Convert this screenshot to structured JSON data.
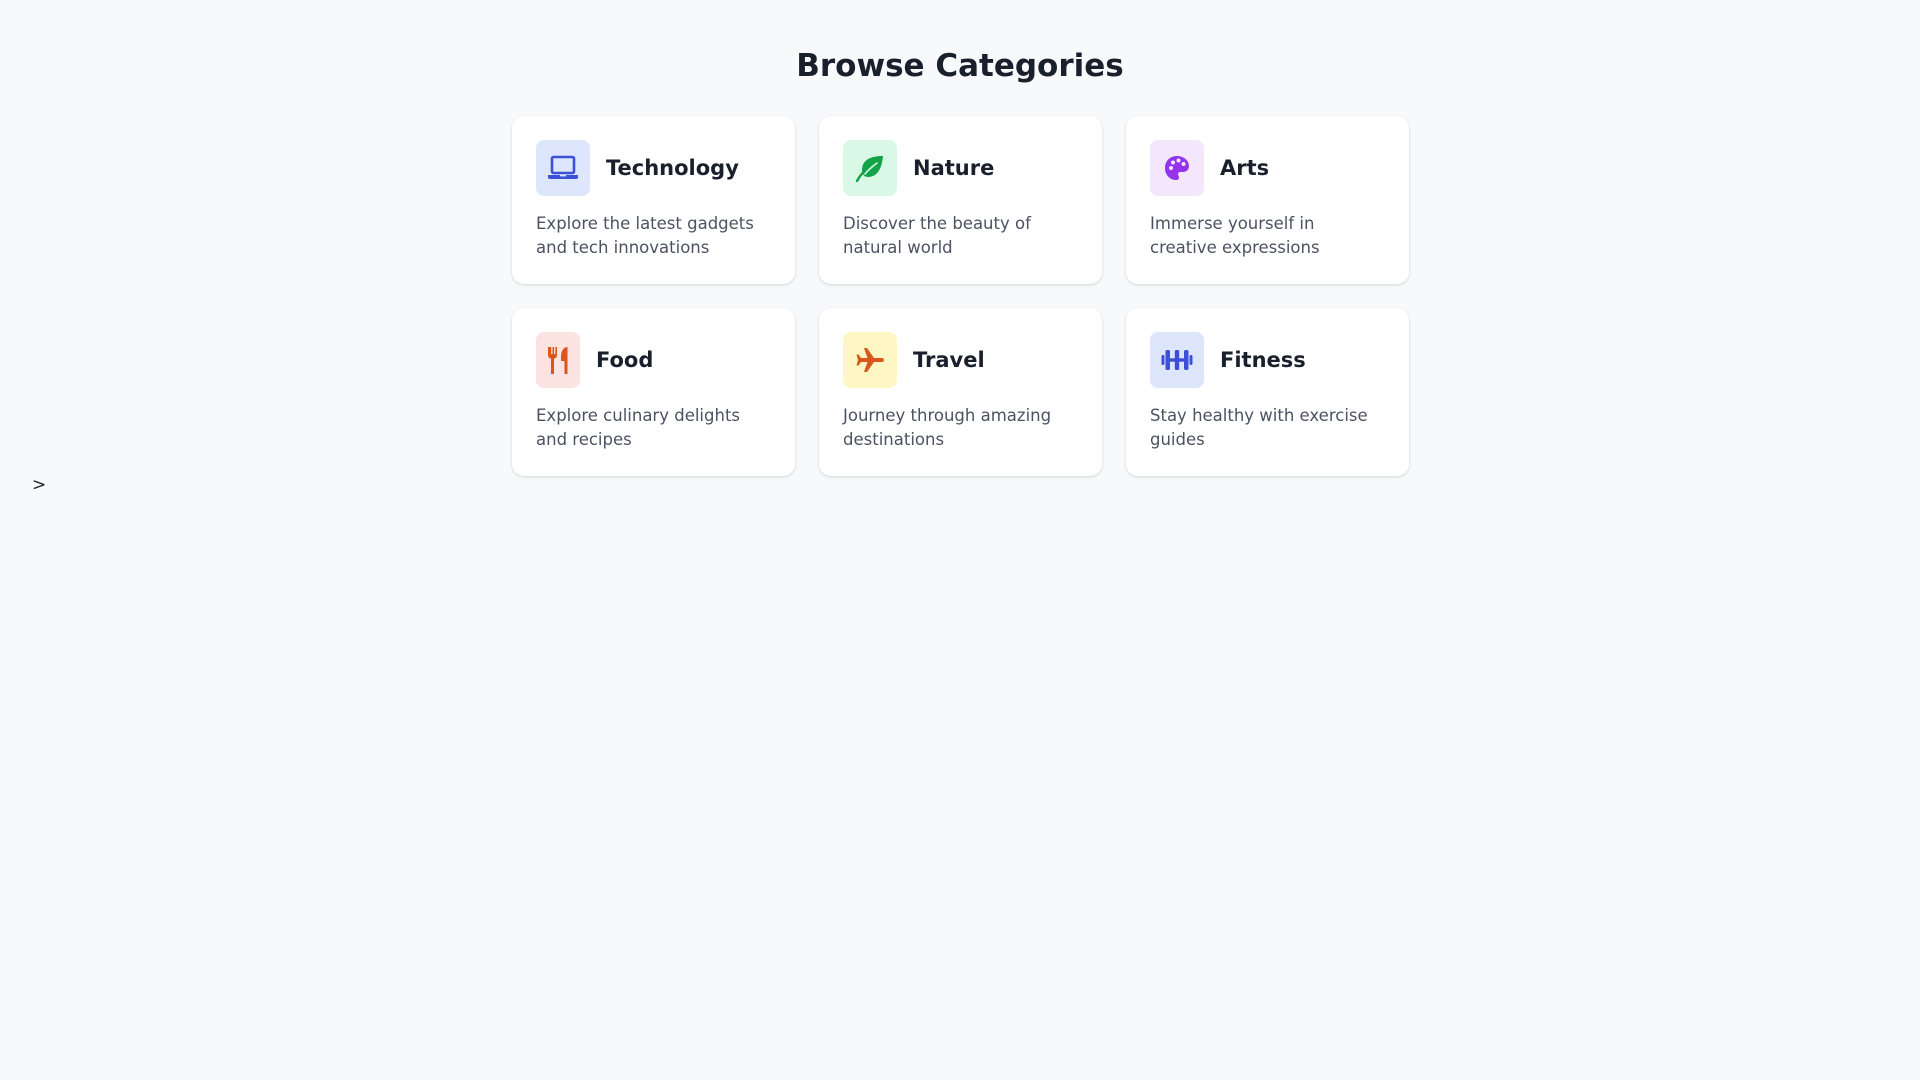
{
  "page": {
    "title": "Browse Categories",
    "stray_text": ">"
  },
  "categories": [
    {
      "title": "Technology",
      "description": "Explore the latest gadgets and tech innovations",
      "icon": "laptop-icon",
      "icon_bg": "#dde6fd",
      "icon_color": "#3c50d8"
    },
    {
      "title": "Nature",
      "description": "Discover the beauty of natural world",
      "icon": "leaf-icon",
      "icon_bg": "#d9f9e6",
      "icon_color": "#15a34a"
    },
    {
      "title": "Arts",
      "description": "Immerse yourself in creative expressions",
      "icon": "palette-icon",
      "icon_bg": "#f4e6fd",
      "icon_color": "#9333ea"
    },
    {
      "title": "Food",
      "description": "Explore culinary delights and recipes",
      "icon": "utensils-icon",
      "icon_bg": "#fde2e2",
      "icon_color": "#d9571a"
    },
    {
      "title": "Travel",
      "description": "Journey through amazing destinations",
      "icon": "plane-icon",
      "icon_bg": "#fef6c3",
      "icon_color": "#d9571a"
    },
    {
      "title": "Fitness",
      "description": "Stay healthy with exercise guides",
      "icon": "dumbbell-icon",
      "icon_bg": "#dde6fd",
      "icon_color": "#3c50d8"
    }
  ]
}
